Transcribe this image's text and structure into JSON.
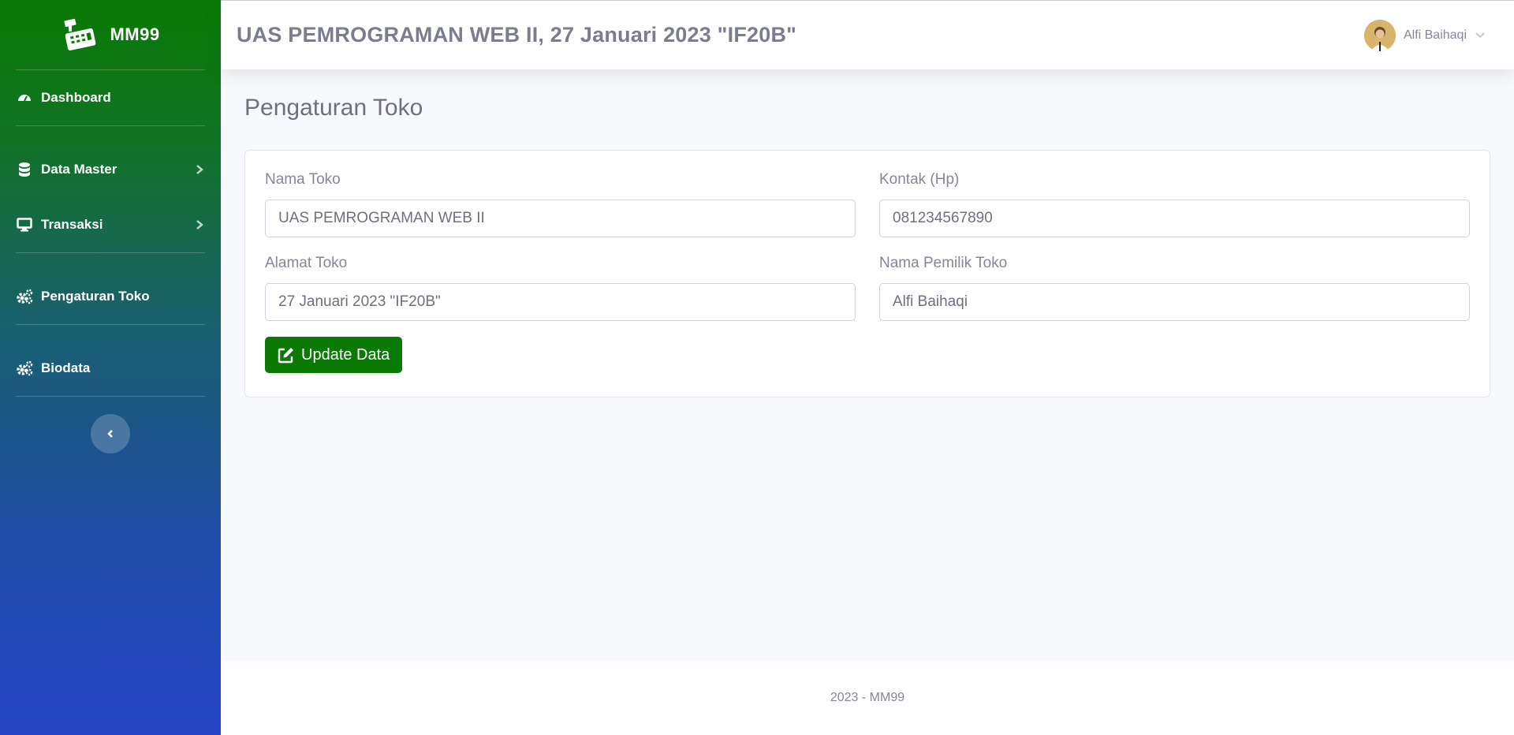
{
  "brand": {
    "name": "MM99",
    "icon": "cash-register-icon"
  },
  "sidebar": {
    "items": [
      {
        "label": "Dashboard",
        "icon": "tachometer-icon",
        "has_submenu": false
      },
      {
        "label": "Data Master",
        "icon": "database-icon",
        "has_submenu": true
      },
      {
        "label": "Transaksi",
        "icon": "desktop-icon",
        "has_submenu": true
      },
      {
        "label": "Pengaturan Toko",
        "icon": "cogs-icon",
        "has_submenu": false
      },
      {
        "label": "Biodata",
        "icon": "cogs-icon",
        "has_submenu": false
      }
    ],
    "toggle_icon": "chevron-left-icon"
  },
  "topbar": {
    "title": "UAS PEMROGRAMAN WEB II, 27 Januari 2023 \"IF20B\"",
    "user_name": "Alfi Baihaqi"
  },
  "main": {
    "page_title": "Pengaturan Toko",
    "form": {
      "nama_toko": {
        "label": "Nama Toko",
        "value": "UAS PEMROGRAMAN WEB II"
      },
      "kontak": {
        "label": "Kontak (Hp)",
        "value": "081234567890"
      },
      "alamat_toko": {
        "label": "Alamat Toko",
        "value": "27 Januari 2023 \"IF20B\""
      },
      "nama_pemilik": {
        "label": "Nama Pemilik Toko",
        "value": "Alfi Baihaqi"
      },
      "update_button": "Update Data"
    }
  },
  "footer": {
    "text": "2023 - MM99"
  },
  "colors": {
    "primary": "#0a7a05",
    "sidebar_bottom": "#2344c4",
    "text_muted": "#858796"
  }
}
